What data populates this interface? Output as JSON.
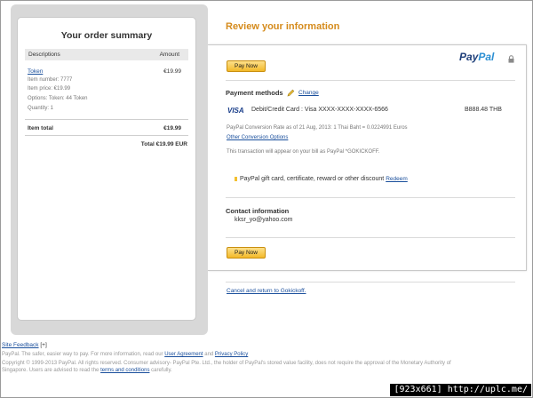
{
  "summary": {
    "title": "Your order summary",
    "col_descriptions": "Descriptions",
    "col_amount": "Amount",
    "item_name": "Token",
    "item_amount": "€19.99",
    "item_number": "Item number: 7777",
    "item_price": "Item price: €19.99",
    "item_options": "Options: Token: 44 Token",
    "item_quantity": "Quantity: 1",
    "total_label": "Item total",
    "total_value": "€19.99",
    "grand_total": "Total €19.99 EUR"
  },
  "review": {
    "title": "Review your information",
    "pay_now_label": "Pay Now",
    "paypal_logo_pay": "Pay",
    "paypal_logo_pal": "Pal",
    "payment_methods_label": "Payment methods",
    "change_link": "Change",
    "visa_label": "VISA",
    "card_text": "Debit/Credit Card : Visa XXXX-XXXX-XXXX-6566",
    "card_amount": "B888.48 THB",
    "conversion_rate": "PayPal Conversion Rate as of 21 Aug, 2013: 1 Thai Baht = 0.0224991 Euros",
    "other_conversion_link": "Other Conversion Options",
    "statement_text": "This transaction will appear on your bill as PayPal *GOKICKOFF.",
    "gift_text": "PayPal gift card, certificate, reward or other discount",
    "redeem_link": "Redeem",
    "contact_label": "Contact information",
    "email": "kksr_yo@yahoo.com",
    "cancel_link": "Cancel and return to Gokickoff."
  },
  "footer": {
    "site_feedback": "Site Feedback",
    "site_feedback_suffix": "[+]",
    "line1_text": "PayPal. The safer, easier way to pay. For more information, read our",
    "user_agreement": "User Agreement",
    "and_text": "and",
    "privacy_policy": "Privacy Policy",
    "line2_text": "Copyright © 1999-2013 PayPal. All rights reserved. Consumer advisory- PayPal Pte. Ltd., the holder of PayPal's stored value facility, does not require the approval of the Monetary Authority of",
    "line3_text": "Singapore. Users are advised to read the",
    "terms_link": "terms and conditions",
    "line3_suffix": "carefully."
  },
  "watermark": "[923x661] http://uplc.me/",
  "colors": {
    "accent_orange": "#d58b1c",
    "link_blue": "#1a4f9c",
    "button_yellow": "#f3b92a"
  }
}
